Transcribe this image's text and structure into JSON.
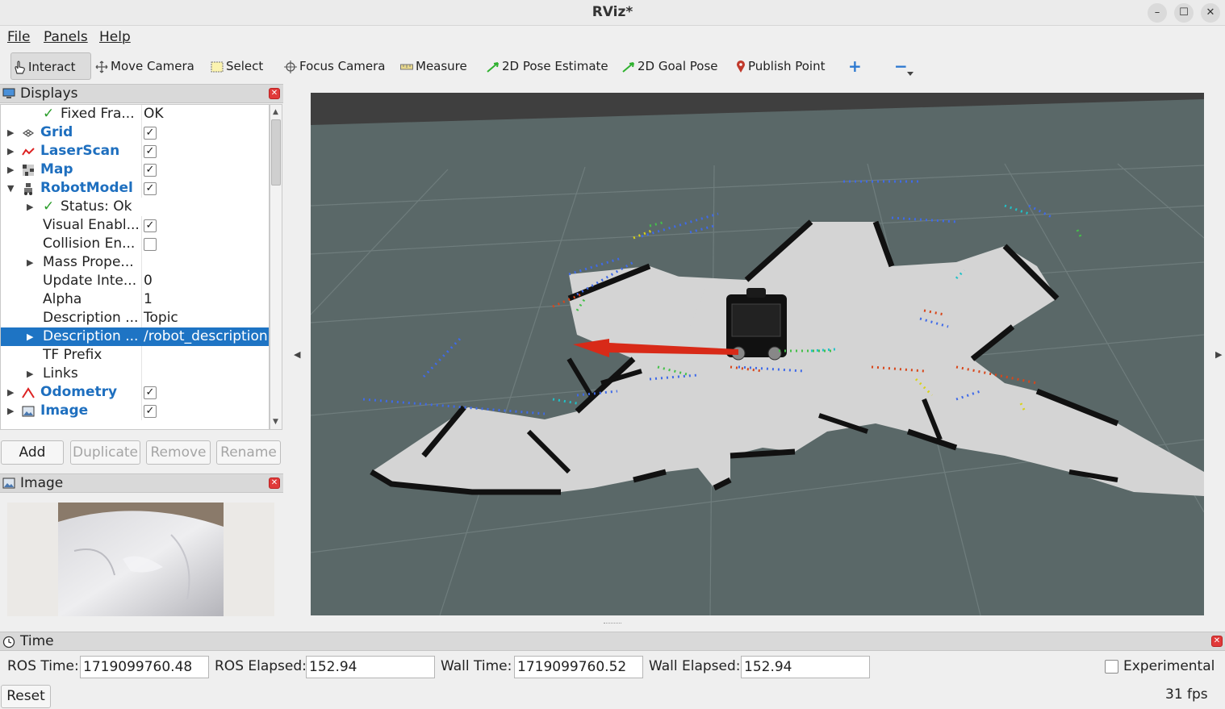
{
  "window": {
    "title": "RViz*",
    "min_label": "–",
    "max_label": "☐",
    "close_label": "✕"
  },
  "menu": {
    "file": "File",
    "panels": "Panels",
    "help": "Help"
  },
  "toolbar": {
    "interact": "Interact",
    "move_camera": "Move Camera",
    "select": "Select",
    "focus_camera": "Focus Camera",
    "measure": "Measure",
    "pose_estimate": "2D Pose Estimate",
    "goal_pose": "2D Goal Pose",
    "publish_point": "Publish Point",
    "add_tool": "+",
    "remove_tool": "−"
  },
  "displays": {
    "title": "Displays",
    "rows": [
      {
        "name": "Fixed Fra...",
        "value": "OK",
        "check": "✓"
      },
      {
        "name": "Grid",
        "checked": "✓"
      },
      {
        "name": "LaserScan",
        "checked": "✓"
      },
      {
        "name": "Map",
        "checked": "✓"
      },
      {
        "name": "RobotModel",
        "checked": "✓"
      },
      {
        "name": "Status: Ok",
        "check": "✓"
      },
      {
        "name": "Visual Enabl...",
        "checked": "✓"
      },
      {
        "name": "Collision En...",
        "checked": ""
      },
      {
        "name": "Mass Prope..."
      },
      {
        "name": "Update Inte...",
        "value": "0"
      },
      {
        "name": "Alpha",
        "value": "1"
      },
      {
        "name": "Description ...",
        "value": "Topic"
      },
      {
        "name": "Description ...",
        "value": "/robot_description"
      },
      {
        "name": "TF Prefix"
      },
      {
        "name": "Links"
      },
      {
        "name": "Odometry",
        "checked": "✓"
      },
      {
        "name": "Image",
        "checked": "✓"
      }
    ],
    "buttons": {
      "add": "Add",
      "duplicate": "Duplicate",
      "remove": "Remove",
      "rename": "Rename"
    }
  },
  "image_panel": {
    "title": "Image"
  },
  "time_panel": {
    "title": "Time",
    "ros_time_label": "ROS Time:",
    "ros_time": "1719099760.48",
    "ros_elapsed_label": "ROS Elapsed:",
    "ros_elapsed": "152.94",
    "wall_time_label": "Wall Time:",
    "wall_time": "1719099760.52",
    "wall_elapsed_label": "Wall Elapsed:",
    "wall_elapsed": "152.94",
    "experimental_label": "Experimental",
    "reset": "Reset",
    "fps": "31 fps"
  },
  "colors": {
    "selection": "#1e74c4",
    "display_name": "#1e6fbf",
    "viewport_bg": "#5a6868",
    "close_red": "#e13a3a"
  }
}
